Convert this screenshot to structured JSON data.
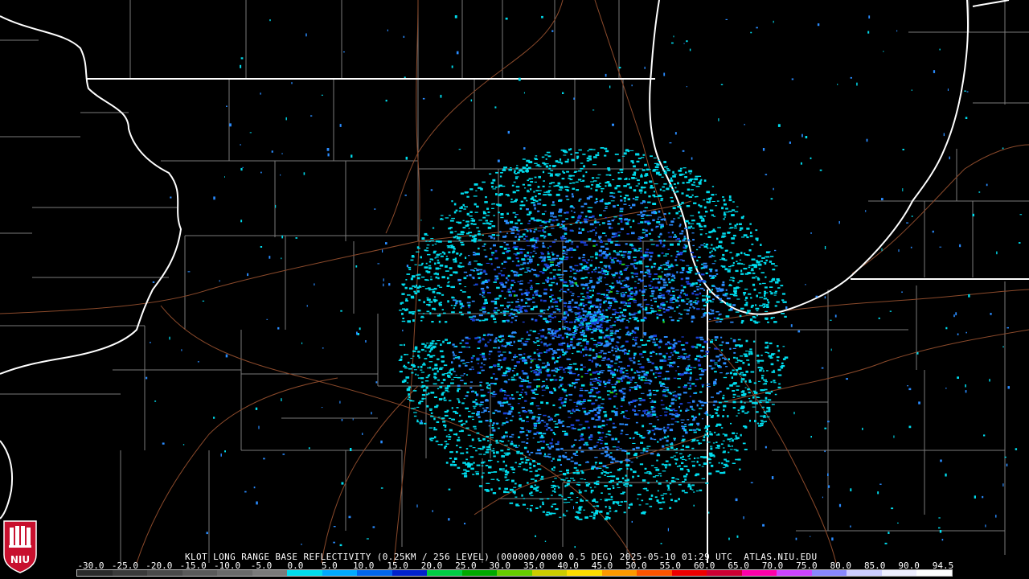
{
  "product": {
    "title": "KLOT LONG RANGE BASE REFLECTIVITY (0.25KM / 256 LEVEL) (000000/0000 0.5 DEG) 2025-05-10 01:29 UTC  ATLAS.NIU.EDU"
  },
  "logo": {
    "text": "NIU",
    "color": "#c8102e"
  },
  "scale": {
    "labels": [
      "-30.0",
      "-25.0",
      "-20.0",
      "-15.0",
      "-10.0",
      "-5.0",
      "0.0",
      "5.0",
      "10.0",
      "15.0",
      "20.0",
      "25.0",
      "30.0",
      "35.0",
      "40.0",
      "45.0",
      "50.0",
      "55.0",
      "60.0",
      "65.0",
      "70.0",
      "75.0",
      "80.0",
      "85.0",
      "90.0",
      "94.5"
    ],
    "colors": [
      "#2a2a2a",
      "#3a3a3a",
      "#4a4a4a",
      "#5a5a5a",
      "#6a6a6a",
      "#7a7a7a",
      "#00ddee",
      "#00aaff",
      "#0066ee",
      "#0022cc",
      "#00cc44",
      "#00aa00",
      "#66cc00",
      "#cccc00",
      "#ffdd00",
      "#ff9900",
      "#ff5500",
      "#ee0000",
      "#cc0033",
      "#ff00aa",
      "#cc44ff",
      "#8888ff",
      "#ccccff",
      "#eeeeff",
      "#ffffff"
    ]
  },
  "map_style": {
    "background": "#000000",
    "state_line_color": "#ffffff",
    "county_line_color": "#7a7a7a",
    "road_color": "#8b4a2b",
    "reflectivity_light": "#00ddee",
    "reflectivity_mid": "#2a8cff",
    "reflectivity_dark": "#1a40d8",
    "reflectivity_high": "#22cc22"
  }
}
